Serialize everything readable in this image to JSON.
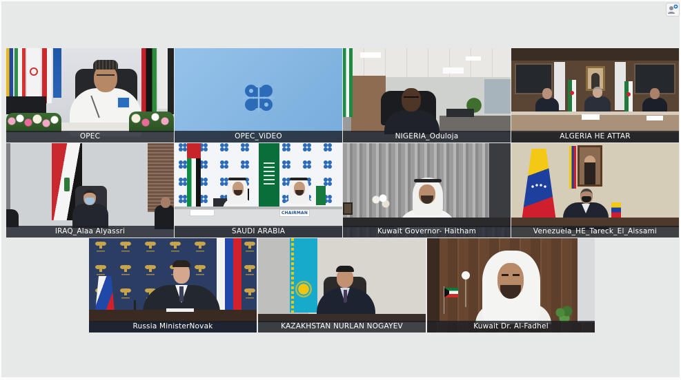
{
  "screen": {
    "background": "#e7e8e8"
  },
  "toolbar": {
    "participants_icon": "participants-icon",
    "badge_color": "#2b7bd6"
  },
  "colors": {
    "label_bar": "#1a1e26",
    "opec_blue": "#2b6bb8"
  },
  "tiles": [
    {
      "label": "OPEC"
    },
    {
      "label": "OPEC_ViDEO"
    },
    {
      "label": "NIGERIA_Oduloja"
    },
    {
      "label": "ALGERIA HE ATTAR"
    },
    {
      "label": "IRAQ_Alaa Alyassri"
    },
    {
      "label": "SAUDI ARABIA",
      "nameplate": "CHAIRMAN"
    },
    {
      "label": "Kuwait Governor- Haitham"
    },
    {
      "label": "Venezuela_HE_Tareck_El_Aissami"
    },
    {
      "label": "Russia MinisterNovak"
    },
    {
      "label": "KAZAKHSTAN NURLAN NOGAYEV"
    },
    {
      "label": "Kuwait Dr. Al-Fadhel"
    }
  ]
}
